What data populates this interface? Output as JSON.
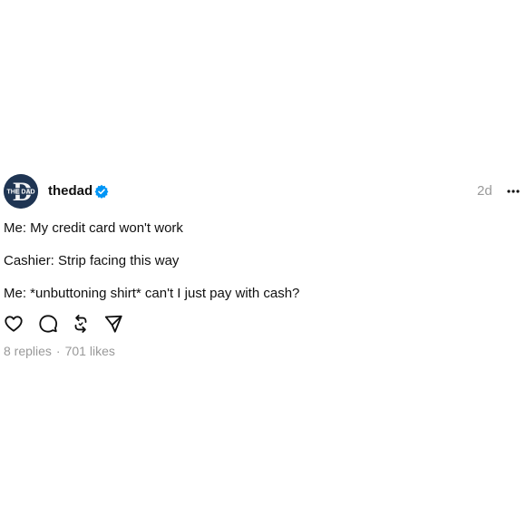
{
  "post": {
    "author": {
      "username": "thedad",
      "avatar_text": "THE DAD",
      "verified": true,
      "verified_color": "#0095f6"
    },
    "time": "2d",
    "more_icon": "ellipsis-icon",
    "lines": [
      "Me: My credit card won't work",
      "Cashier: Strip facing this way",
      "Me: *unbuttoning shirt* can't I just pay with cash?"
    ],
    "actions": [
      "heart-icon",
      "comment-icon",
      "repost-icon",
      "share-icon"
    ],
    "stats": {
      "replies": "8 replies",
      "separator": "·",
      "likes": "701 likes"
    }
  },
  "colors": {
    "text": "#101010",
    "muted": "#999999",
    "avatar_bg": "#1f3553"
  }
}
